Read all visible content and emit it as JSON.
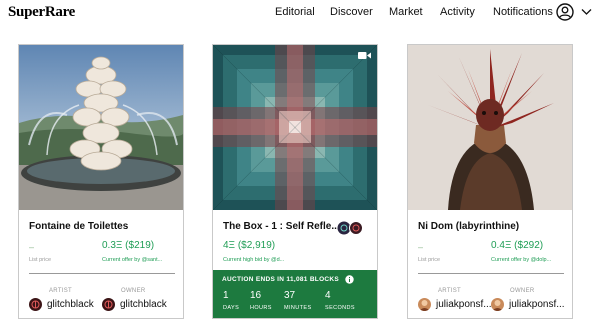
{
  "header": {
    "logo": "SuperRare",
    "nav": [
      "Editorial",
      "Discover",
      "Market",
      "Activity",
      "Notifications"
    ],
    "profile_icon": "user-circle-icon",
    "menu_icon": "chevron-down-icon"
  },
  "cards": [
    {
      "title": "Fontaine de Toilettes",
      "list_price": "–",
      "list_price_label": "List price",
      "offer_price": "0.3Ξ ($219)",
      "offer_label": "Current offer by @sant...",
      "artist_label": "ARTIST",
      "artist": "glitchblack",
      "owner_label": "OWNER",
      "owner": "glitchblack"
    },
    {
      "title": "The Box - 1 : Self Refle...",
      "price": "4Ξ ($2,919)",
      "bid_label": "Current high bid by @d...",
      "media_icon": "video-camera-icon",
      "auction": {
        "title": "AUCTION ENDS IN 11,081 BLOCKS",
        "info_icon": "info-icon",
        "countdown": [
          {
            "value": "1",
            "label": "DAYS"
          },
          {
            "value": "16",
            "label": "HOURS"
          },
          {
            "value": "37",
            "label": "MINUTES"
          },
          {
            "value": "4",
            "label": "SECONDS"
          }
        ]
      }
    },
    {
      "title": "Ni Dom (labyrinthine)",
      "list_price": "–",
      "list_price_label": "List price",
      "offer_price": "0.4Ξ ($292)",
      "offer_label": "Current offer by @dolp...",
      "artist_label": "ARTIST",
      "artist": "juliakponsf...",
      "owner_label": "OWNER",
      "owner": "juliakponsf..."
    }
  ],
  "colors": {
    "price_green": "#1f9d55",
    "auction_green": "#1d7a3f"
  }
}
